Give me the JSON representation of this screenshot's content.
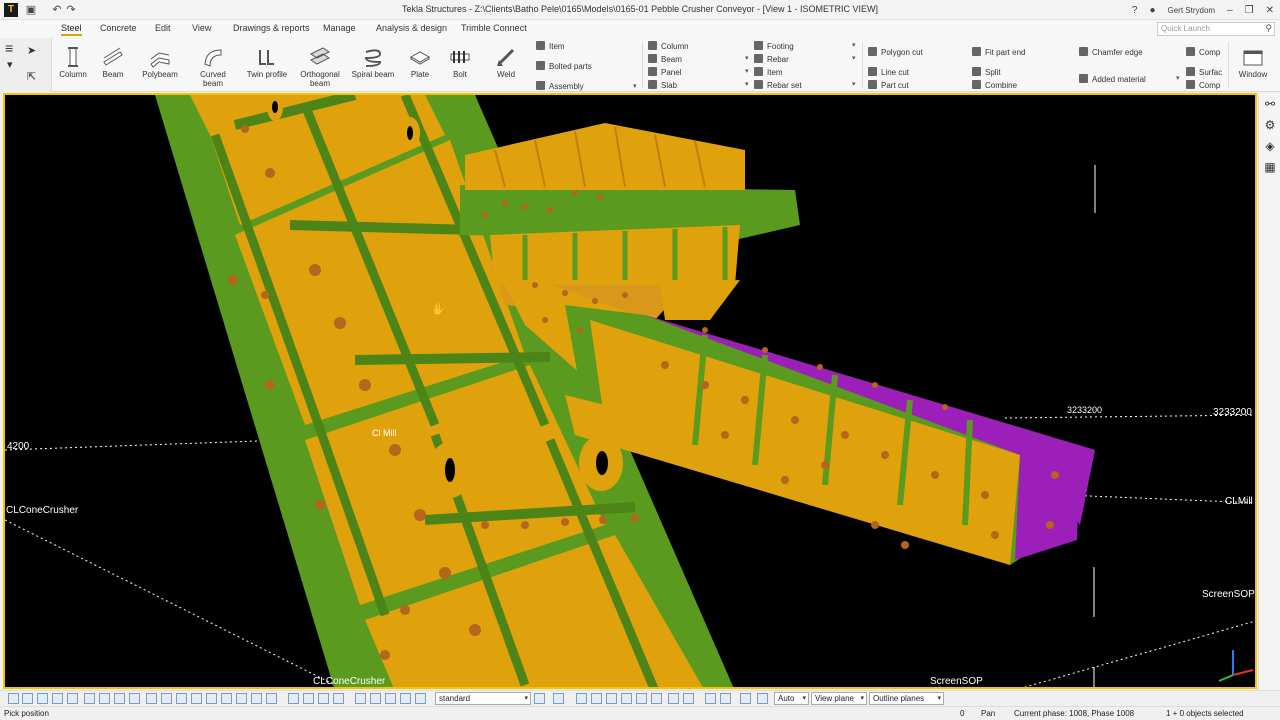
{
  "titlebar": {
    "title": "Tekla Structures - Z:\\Clients\\Batho Pele\\0165\\Models\\0165-01 Pebble Crusher Conveyor  - [View 1 - ISOMETRIC VIEW]",
    "user": "Gert Strydom",
    "help": "?"
  },
  "menu": {
    "tabs": [
      "Steel",
      "Concrete",
      "Edit",
      "View",
      "Drawings & reports",
      "Manage",
      "Analysis & design",
      "Trimble Connect"
    ],
    "active": "Steel",
    "quick_launch_placeholder": "Quick Launch"
  },
  "ribbon": {
    "big_buttons": [
      {
        "label": "Column",
        "icon": "column-icon"
      },
      {
        "label": "Beam",
        "icon": "beam-icon"
      },
      {
        "label": "Polybeam",
        "icon": "polybeam-icon"
      },
      {
        "label": "Curved beam",
        "icon": "curved-beam-icon"
      },
      {
        "label": "Twin profile",
        "icon": "twin-profile-icon"
      },
      {
        "label": "Orthogonal beam",
        "icon": "orthogonal-beam-icon"
      },
      {
        "label": "Spiral beam",
        "icon": "spiral-beam-icon"
      },
      {
        "label": "Plate",
        "icon": "plate-icon"
      },
      {
        "label": "Bolt",
        "icon": "bolt-icon"
      },
      {
        "label": "Weld",
        "icon": "weld-icon"
      }
    ],
    "steel_small": [
      "Item",
      "Bolted parts",
      "Assembly"
    ],
    "concrete_col1": [
      "Column",
      "Beam",
      "Panel",
      "Slab"
    ],
    "concrete_col2": [
      "Footing",
      "Rebar",
      "Item",
      "Rebar set"
    ],
    "edit_col1": [
      "Polygon cut",
      "Line cut",
      "Part cut"
    ],
    "edit_col2": [
      "Fit part end",
      "Split",
      "Combine"
    ],
    "edit_col3": [
      "Chamfer edge",
      "Added material"
    ],
    "edit_col4": [
      "Comp",
      "Surfac",
      "Comp"
    ],
    "window_label": "Window"
  },
  "viewport": {
    "labels": {
      "grid_4200": "4200",
      "cl_cone_crusher_left": "CLConeCrusher",
      "cl_mill_center": "Cl Mill",
      "elev_3233200_a": "3233200",
      "elev_3233200_b": "3233200",
      "cl_mill_right": "CLMill",
      "screen_sop_right": "ScreenSOP",
      "cl_cone_crusher_bottom": "CLConeCrusher",
      "screen_sop_bottom": "ScreenSOP"
    },
    "colors": {
      "background": "#000000",
      "steel_yellow": "#e0a20c",
      "steel_green": "#5a9a1e",
      "steel_purple": "#9b1fb8",
      "bolt_orange": "#b5651d",
      "frame": "#f5c400"
    }
  },
  "snapbar": {
    "view_filter": "standard",
    "auto": "Auto",
    "view_plane": "View plane",
    "outline_planes": "Outline planes"
  },
  "status": {
    "left": "Pick position",
    "zero": "0",
    "mode": "Pan",
    "phase": "Current phase: 1008, Phase 1008",
    "selected": "1 + 0 objects selected"
  }
}
